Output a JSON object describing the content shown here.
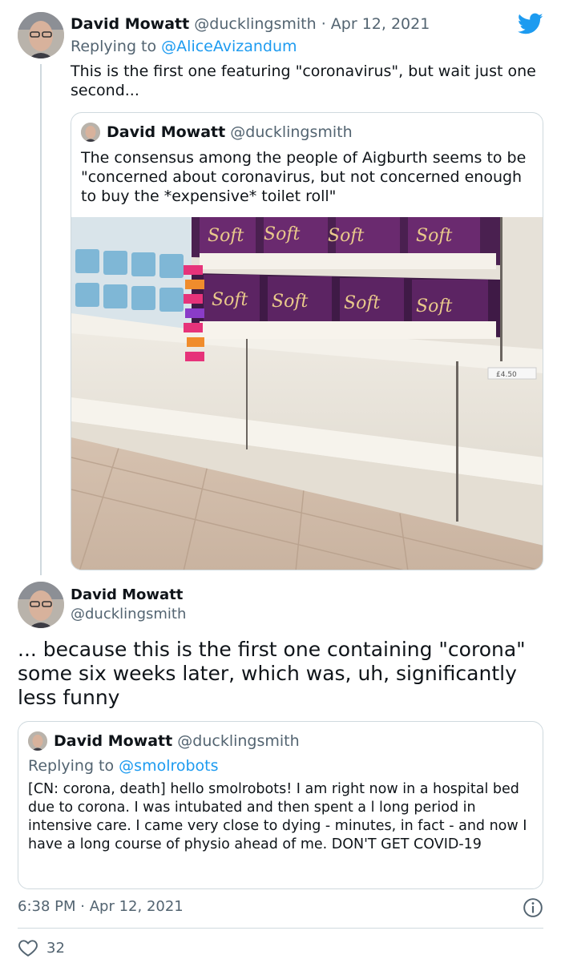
{
  "tweet": {
    "author_name": "David Mowatt",
    "author_handle": "@ducklingsmith",
    "separator": "·",
    "date": "Apr 12, 2021",
    "replying_prefix": "Replying to",
    "replying_to": "@AliceAvizandum",
    "text": "This is the first one featuring \"coronavirus\", but wait just one second...",
    "quoted": {
      "author_name": "David Mowatt",
      "author_handle": "@ducklingsmith",
      "text": "The consensus among the people of Aigburth seems to be \"concerned about coronavirus, but not concerned enough to buy the *expensive* toilet roll\"",
      "photo_labels": [
        "Soft",
        "Soft",
        "Soft",
        "Soft",
        "Soft",
        "Soft",
        "Soft",
        "Soft",
        "£4.50"
      ]
    }
  },
  "reply_tweet": {
    "author_name": "David Mowatt",
    "author_handle": "@ducklingsmith",
    "text": "... because this is the first one containing \"corona\" some six weeks later, which was, uh, significantly less funny",
    "quoted": {
      "author_name": "David Mowatt",
      "author_handle": "@ducklingsmith",
      "replying_prefix": "Replying to",
      "replying_to": "@smolrobots",
      "text": "[CN: corona, death] hello smolrobots! I am right now in a hospital bed due to corona. I was intubated and then spent a l long period in intensive care. I came very close to dying - minutes, in fact - and now I have a long course of physio ahead of me. DON'T GET COVID-19"
    },
    "time": "6:38 PM",
    "separator": "·",
    "date": "Apr 12, 2021",
    "like_count": "32"
  },
  "colors": {
    "brand": "#1d9bf0",
    "text": "#0f1419",
    "muted": "#536471",
    "border": "#cfd9de"
  },
  "icons": [
    "twitter-bird-icon",
    "info-icon",
    "heart-icon"
  ]
}
